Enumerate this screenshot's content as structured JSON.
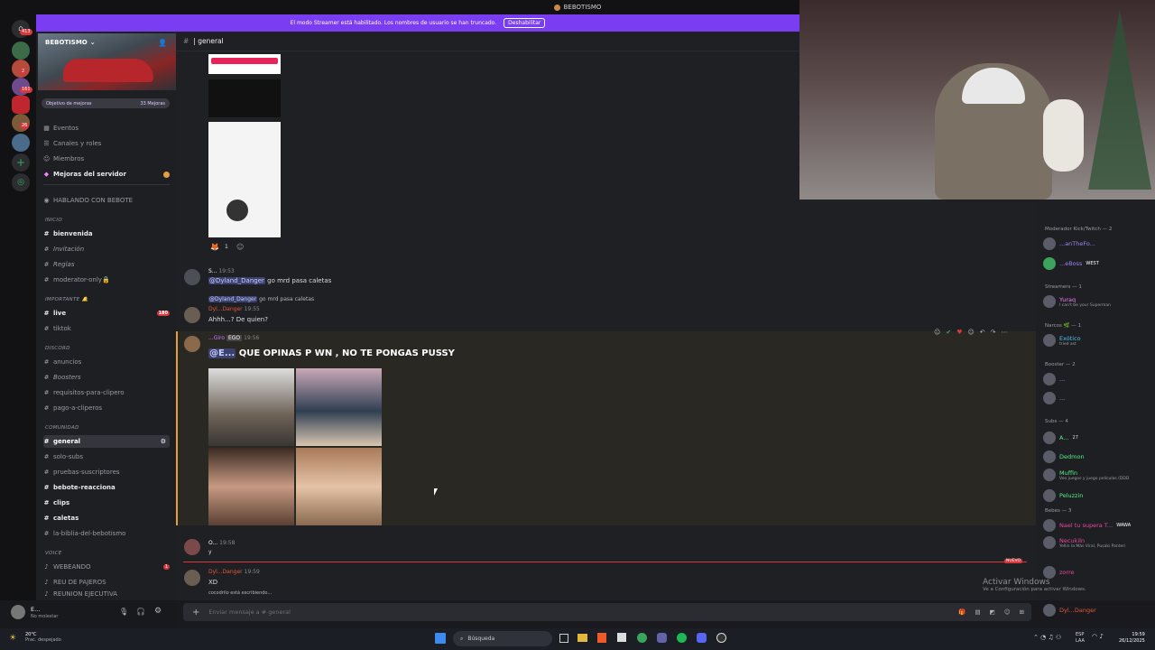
{
  "window": {
    "title": "BEBOTISMO"
  },
  "guild_badges": [
    "413",
    "2",
    "161",
    "26"
  ],
  "streamer_bar": {
    "text": "El modo Streamer está habilitado. Los nombres de usuario se han truncado.",
    "button": "Deshabilitar"
  },
  "server": {
    "name": "BEBOTISMO",
    "boost_goal": "Objetivo de mejoras",
    "boost_count": "33 Mejoras"
  },
  "sidebar": {
    "top_items": [
      "Eventos",
      "Canales y roles",
      "Miembros",
      "Mejoras del servidor"
    ],
    "hablando": "HABLANDO CON BEBOTE",
    "cat_inicio": "INICIO",
    "inicio": [
      "bienvenida",
      "Invitación",
      "Reglas",
      "moderator-only🔒"
    ],
    "cat_importante": "IMPORTANTE 🔔",
    "importante": [
      "live",
      "tiktok"
    ],
    "live_badge": "180",
    "cat_discord": "DISCORD",
    "discord": [
      "anuncios",
      "Boosters",
      "requisitos-para-clipero",
      "pago-a-cliperos"
    ],
    "cat_comunidad": "COMUNIDAD",
    "comunidad": [
      "general",
      "solo-subs",
      "pruebas-suscriptores",
      "bebote-reacciona",
      "clips",
      "caletas",
      "la-biblia-del-bebotismo"
    ],
    "cat_voice": "VOICE",
    "voice": [
      "WEBEANDO",
      "REU DE PAJEROS",
      "REUNION EJECUTIVA"
    ],
    "voice_badge": "1"
  },
  "user": {
    "name": "E...",
    "status": "No molestar"
  },
  "channel": {
    "name": "| general"
  },
  "messages": {
    "m1_name": "S...",
    "m1_time": "19:53",
    "m1_mention": "@Dyland_Danger",
    "m1_text": "go mrd pasa caletas",
    "reply_mention": "@Dyland_Danger",
    "reply_text": "go mrd pasa caletas",
    "m2_name": "Dyl...Danger",
    "m2_time": "19:55",
    "m2_text": "Ahhh...? De quien?",
    "m3_name": "...Giro",
    "m3_tag": "EGO",
    "m3_time": "19:56",
    "m3_mention": "@E...",
    "m3_text": "QUE OPINAS P WN , NO TE PONGAS PUSSY",
    "m4_name": "O...",
    "m4_time": "19:58",
    "m4_text": "y",
    "new_label": "NUEVO",
    "m5_name": "Dyl...Danger",
    "m5_time": "19:59",
    "m5_text": "XD",
    "typing": "cocodrilo está escribiendo...",
    "reaction_count": "1"
  },
  "composer": {
    "placeholder": "Enviar mensaje a #",
    "channel": "general"
  },
  "members": {
    "cat_mod": "Moderador Kick/Twitch — 2",
    "mod1": "...anTheFo...",
    "mod2": "...eBoss",
    "mod2_tag": "WEST",
    "cat_streamers": "Streamers — 1",
    "streamer1": "Yuraq",
    "streamer1_sub": "I can't be your Superman",
    "cat_narcos": "Narcos 🌿 — 1",
    "narco1": "Exótico",
    "narco1_sub": "tried ast",
    "cat_booster": "Booster — 2",
    "cat_subs": "Subs — 4",
    "sub1": "A...",
    "sub1_num": "27",
    "sub2": "Dedmon",
    "sub3": "Muffin",
    "sub3_sub": "Veo juegos y juego películas (DDD",
    "sub4": "Peluzzin",
    "cat_bebes": "Bebes — 3",
    "bebe1": "Nael tu supera T...",
    "bebe1_tag": "WAWA",
    "bebe2": "Necukiln",
    "bebe2_sub": "Yellin la Más Viral, Pușaki Panteri",
    "bebe3": "zorre",
    "bebe4": "Dyl...Danger"
  },
  "watermark": {
    "line1": "Activar Windows",
    "line2": "Ve a Configuración para activar Windows."
  },
  "taskbar": {
    "weather": "20°C",
    "weather_sub": "Prac. despejado",
    "search": "Búsqueda",
    "lang": "ESP",
    "lang2": "LAA",
    "time": "19:59",
    "date": "26/12/2025"
  }
}
